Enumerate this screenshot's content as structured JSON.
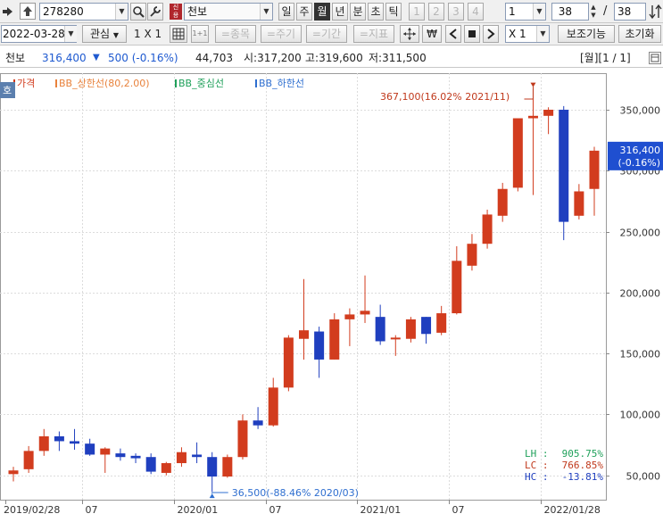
{
  "toolbar": {
    "code": "278280",
    "stock_name": "천보",
    "periods": [
      "일",
      "주",
      "월",
      "년",
      "분",
      "초",
      "틱"
    ],
    "selected_period": "월",
    "minute_buttons": [
      "1",
      "2",
      "3",
      "4"
    ],
    "minute_value": "1",
    "count_value": "38",
    "count_total": "38"
  },
  "toolbar2": {
    "date": "2022-03-28",
    "watch_label": "관심",
    "layout_label": "1 X 1",
    "stock_btn": "=종목",
    "cycle_btn": "=주기",
    "period_btn": "=기간",
    "indicator_btn": "=지표",
    "won_symbol": "₩",
    "multiplier": "X 1",
    "aux_label": "보조기능",
    "reset_label": "초기화"
  },
  "infobar": {
    "name": "천보",
    "price": "316,400",
    "change_symbol": "▼",
    "change": "500 (-0.16%)",
    "volume": "44,703",
    "open": "시:317,200",
    "high": "고:319,600",
    "low": "저:311,500",
    "page": "[월][1 / 1]"
  },
  "chart_data": {
    "type": "candlestick",
    "legend": [
      "가격",
      "BB_상한선(80,2.00)",
      "BB_중심선",
      "BB_하한선"
    ],
    "legend_colors": [
      "#d23c1e",
      "#e8823c",
      "#1fa05a",
      "#2f6fd0"
    ],
    "up_color": "#d23c1e",
    "down_color": "#1f3fbf",
    "ylim": [
      30000,
      380000
    ],
    "y_ticks": [
      50000,
      100000,
      150000,
      200000,
      250000,
      300000,
      350000
    ],
    "y_tick_labels": [
      "50,000",
      "100,000",
      "150,000",
      "200,000",
      "250,000",
      "300,000",
      "350,000"
    ],
    "x_tick_labels": [
      {
        "index": 0,
        "label": "2019/02/28"
      },
      {
        "index": 5,
        "label": "07"
      },
      {
        "index": 11,
        "label": "2020/01"
      },
      {
        "index": 17,
        "label": "07"
      },
      {
        "index": 23,
        "label": "2021/01"
      },
      {
        "index": 29,
        "label": "07"
      },
      {
        "index": 35,
        "label": "2022/01/28"
      }
    ],
    "candles": [
      {
        "o": 51000,
        "h": 57000,
        "l": 45000,
        "c": 54000
      },
      {
        "o": 55000,
        "h": 74000,
        "l": 52000,
        "c": 70000
      },
      {
        "o": 70000,
        "h": 88000,
        "l": 66000,
        "c": 82000
      },
      {
        "o": 82000,
        "h": 86000,
        "l": 70000,
        "c": 78000
      },
      {
        "o": 78000,
        "h": 88000,
        "l": 71000,
        "c": 76000
      },
      {
        "o": 76000,
        "h": 80000,
        "l": 66000,
        "c": 67000
      },
      {
        "o": 67000,
        "h": 73000,
        "l": 52000,
        "c": 72000
      },
      {
        "o": 68000,
        "h": 72000,
        "l": 62000,
        "c": 65000
      },
      {
        "o": 66000,
        "h": 68000,
        "l": 60000,
        "c": 64000
      },
      {
        "o": 65000,
        "h": 68000,
        "l": 51000,
        "c": 53000
      },
      {
        "o": 52000,
        "h": 61000,
        "l": 50000,
        "c": 60000
      },
      {
        "o": 60000,
        "h": 73000,
        "l": 57000,
        "c": 69000
      },
      {
        "o": 67000,
        "h": 77000,
        "l": 60000,
        "c": 65000
      },
      {
        "o": 65000,
        "h": 69000,
        "l": 36500,
        "c": 49000
      },
      {
        "o": 49000,
        "h": 67000,
        "l": 48000,
        "c": 65000
      },
      {
        "o": 65000,
        "h": 100000,
        "l": 63000,
        "c": 95000
      },
      {
        "o": 95000,
        "h": 106000,
        "l": 88000,
        "c": 91000
      },
      {
        "o": 91000,
        "h": 130000,
        "l": 90000,
        "c": 122000
      },
      {
        "o": 122000,
        "h": 165000,
        "l": 119000,
        "c": 163000
      },
      {
        "o": 162000,
        "h": 211000,
        "l": 145000,
        "c": 169000
      },
      {
        "o": 168000,
        "h": 172000,
        "l": 130000,
        "c": 145000
      },
      {
        "o": 145000,
        "h": 183000,
        "l": 145000,
        "c": 178000
      },
      {
        "o": 178000,
        "h": 187000,
        "l": 156000,
        "c": 182000
      },
      {
        "o": 182000,
        "h": 214000,
        "l": 175000,
        "c": 185000
      },
      {
        "o": 180000,
        "h": 190000,
        "l": 157000,
        "c": 160000
      },
      {
        "o": 162000,
        "h": 165000,
        "l": 148000,
        "c": 163000
      },
      {
        "o": 162000,
        "h": 180000,
        "l": 159000,
        "c": 178000
      },
      {
        "o": 180000,
        "h": 180000,
        "l": 158000,
        "c": 166000
      },
      {
        "o": 167000,
        "h": 189000,
        "l": 165000,
        "c": 183000
      },
      {
        "o": 183000,
        "h": 238000,
        "l": 182000,
        "c": 226000
      },
      {
        "o": 222000,
        "h": 248000,
        "l": 218000,
        "c": 240000
      },
      {
        "o": 240000,
        "h": 268000,
        "l": 236000,
        "c": 264000
      },
      {
        "o": 263000,
        "h": 290000,
        "l": 258000,
        "c": 285000
      },
      {
        "o": 286000,
        "h": 341000,
        "l": 283000,
        "c": 343000
      },
      {
        "o": 343000,
        "h": 367100,
        "l": 280000,
        "c": 345000
      },
      {
        "o": 345000,
        "h": 352000,
        "l": 330000,
        "c": 350000
      },
      {
        "o": 350000,
        "h": 353000,
        "l": 243000,
        "c": 258000
      },
      {
        "o": 263000,
        "h": 289000,
        "l": 260000,
        "c": 283000
      },
      {
        "o": 285000,
        "h": 319600,
        "l": 263000,
        "c": 316400
      }
    ],
    "max_annotation": "367,100(16.02% 2021/11)",
    "min_annotation": "36,500(-88.46% 2020/03)",
    "current_label": "316,400",
    "current_change": "(-0.16%)",
    "lh": {
      "label": "LH :",
      "value": "905.75%"
    },
    "lc": {
      "label": "LC :",
      "value": "766.85%"
    },
    "hc": {
      "label": "HC :",
      "value": "-13.81%"
    },
    "side_tab": "호"
  }
}
